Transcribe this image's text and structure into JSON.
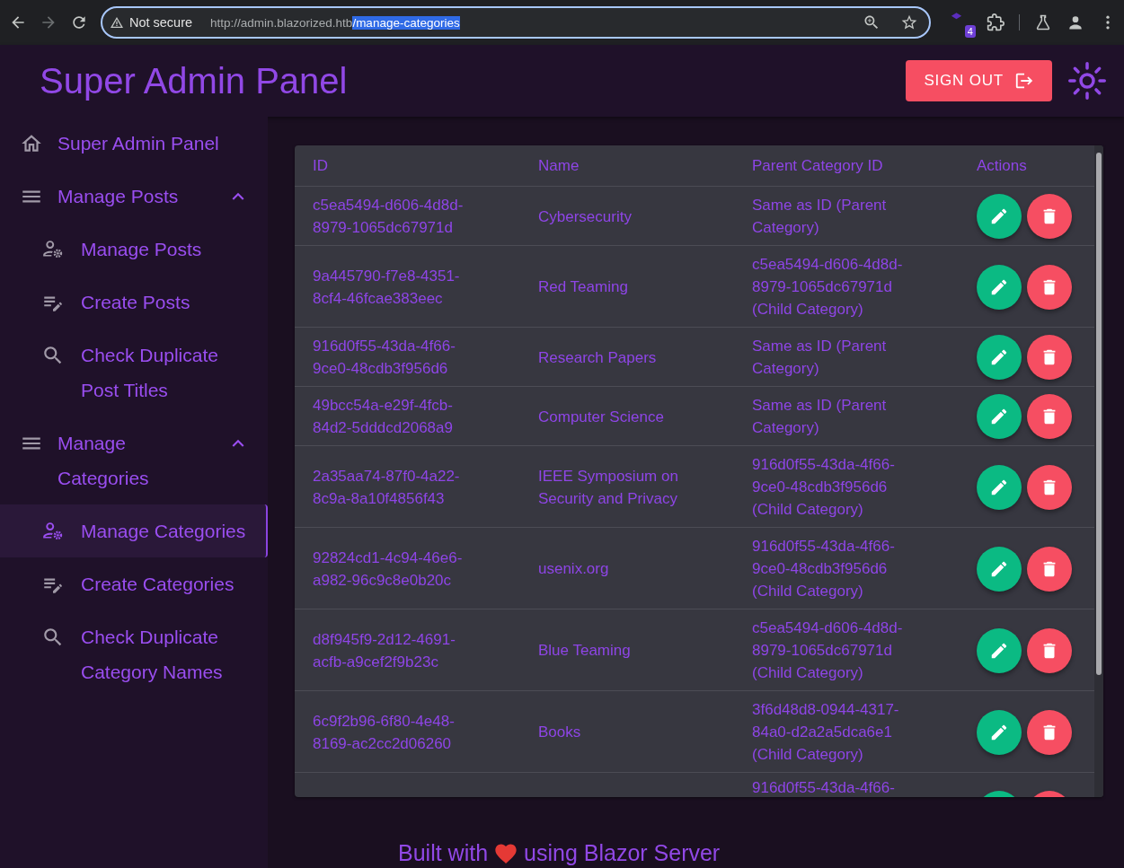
{
  "browser": {
    "security_label": "Not secure",
    "url_host": "http://admin.blazorized.htb",
    "url_path": "/manage-categories",
    "url_path_selected": true,
    "forward_disabled": true,
    "extension_badge": "4"
  },
  "app_bar": {
    "title": "Super Admin Panel",
    "sign_out_label": "SIGN OUT"
  },
  "sidebar": {
    "items": [
      {
        "kind": "link",
        "label": "Super Admin Panel",
        "selected": false
      },
      {
        "kind": "group",
        "label": "Manage Posts",
        "expanded": true,
        "children": [
          {
            "label": "Manage Posts",
            "selected": false
          },
          {
            "label": "Create Posts",
            "selected": false
          },
          {
            "label": "Check Duplicate Post Titles",
            "selected": false
          }
        ]
      },
      {
        "kind": "group",
        "label": "Manage Categories",
        "expanded": true,
        "children": [
          {
            "label": "Manage Categories",
            "selected": true
          },
          {
            "label": "Create Categories",
            "selected": false
          },
          {
            "label": "Check Duplicate Category Names",
            "selected": false
          }
        ]
      }
    ]
  },
  "table": {
    "columns": [
      "ID",
      "Name",
      "Parent Category ID",
      "Actions"
    ],
    "rows": [
      {
        "kind": "full",
        "id": "c5ea5494-d606-4d8d-8979-1065dc67971d",
        "name": "Cybersecurity",
        "parent": "Same as ID (Parent Category)"
      },
      {
        "kind": "full",
        "id": "9a445790-f7e8-4351-8cf4-46fcae383eec",
        "name": "Red Teaming",
        "parent": "c5ea5494-d606-4d8d-8979-1065dc67971d (Child Category)"
      },
      {
        "kind": "full",
        "id": "916d0f55-43da-4f66-9ce0-48cdb3f956d6",
        "name": "Research Papers",
        "parent": "Same as ID (Parent Category)"
      },
      {
        "kind": "full",
        "id": "49bcc54a-e29f-4fcb-84d2-5dddcd2068a9",
        "name": "Computer Science",
        "parent": "Same as ID (Parent Category)"
      },
      {
        "kind": "full",
        "id": "2a35aa74-87f0-4a22-8c9a-8a10f4856f43",
        "name": "IEEE Symposium on Security and Privacy",
        "parent": "916d0f55-43da-4f66-9ce0-48cdb3f956d6 (Child Category)"
      },
      {
        "kind": "full",
        "id": "92824cd1-4c94-46e6-a982-96c9c8e0b20c",
        "name": "usenix.org",
        "parent": "916d0f55-43da-4f66-9ce0-48cdb3f956d6 (Child Category)"
      },
      {
        "kind": "full",
        "id": "d8f945f9-2d12-4691-acfb-a9cef2f9b23c",
        "name": "Blue Teaming",
        "parent": "c5ea5494-d606-4d8d-8979-1065dc67971d (Child Category)"
      },
      {
        "kind": "full",
        "id": "6c9f2b96-6f80-4e48-8169-ac2cc2d06260",
        "name": "Books",
        "parent": "3f6d48d8-0944-4317-84a0-d2a2a5dca6e1 (Child Category)"
      },
      {
        "kind": "cut",
        "parent": "916d0f55-43da-4f66-"
      }
    ]
  },
  "footer": {
    "before": "Built with",
    "after": "using Blazor Server"
  }
}
